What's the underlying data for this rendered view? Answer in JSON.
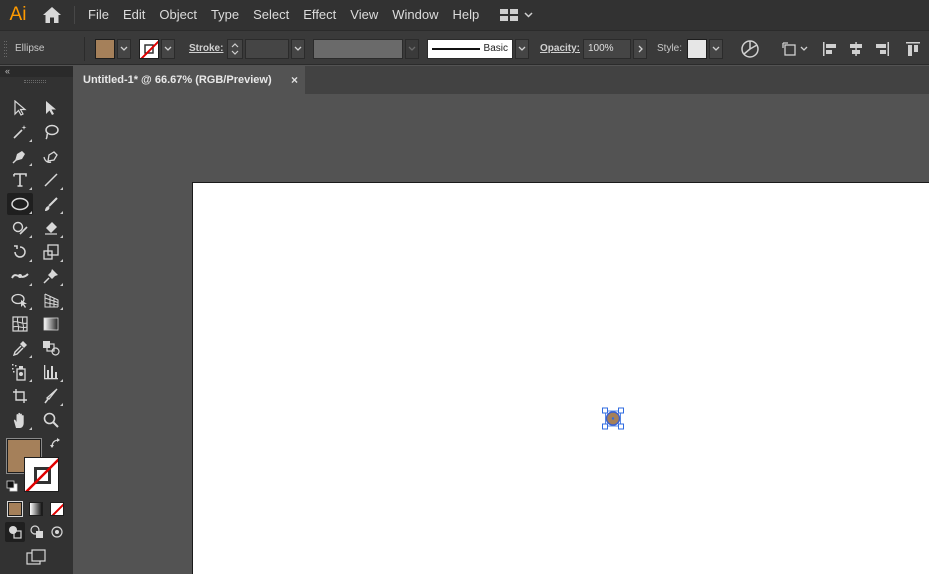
{
  "app": {
    "logo": "Ai"
  },
  "menu": [
    "File",
    "Edit",
    "Object",
    "Type",
    "Select",
    "Effect",
    "View",
    "Window",
    "Help"
  ],
  "control": {
    "tool_name": "Ellipse",
    "stroke_label": "Stroke:",
    "brush_label": "Basic",
    "opacity_label": "Opacity:",
    "opacity_value": "100%",
    "style_label": "Style:"
  },
  "document": {
    "tab_title": "Untitled-1* @ 66.67% (RGB/Preview)",
    "close_glyph": "×"
  },
  "colors": {
    "fill": "#a5805a",
    "stroke": "none",
    "ellipse_stroke": "#3a5fd0",
    "selection": "#2f6be0"
  },
  "icons": {
    "panel_collapse": "«"
  }
}
